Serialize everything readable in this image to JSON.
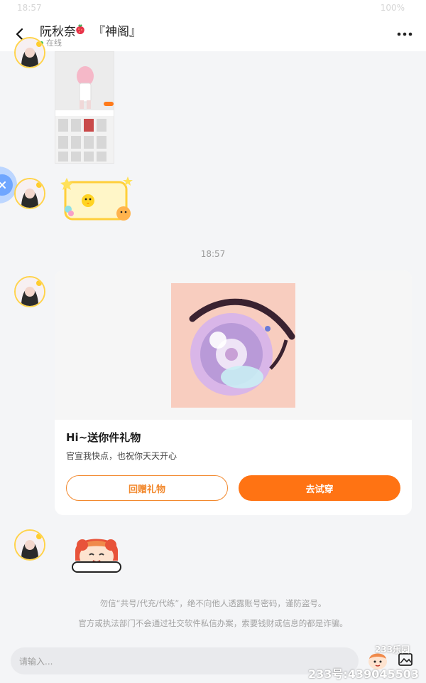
{
  "status_bar": {
    "time": "18:57",
    "system": "100%"
  },
  "header": {
    "contact_name": "阮秋奈",
    "contact_tag": "『神阁』",
    "status": "在线"
  },
  "messages": {
    "timestamp": "18:57",
    "gift_card": {
      "title": "Hi~送你件礼物",
      "subtitle": "官宣我快点，也祝你天天开心",
      "return_button": "回赠礼物",
      "try_button": "去试穿"
    }
  },
  "notices": [
    "勿信“共号/代充/代练”，绝不向他人透露账号密码，谨防盗号。",
    "官方或执法部门不会通过社交软件私信办案，索要钱财或信息的都是诈骗。"
  ],
  "input": {
    "placeholder": "请输入..."
  },
  "watermark": {
    "id": "233号:439045503",
    "logo": "233乐园"
  },
  "colors": {
    "accent": "#ff7313",
    "online": "#3cc35a",
    "background": "#f4f5f7"
  }
}
